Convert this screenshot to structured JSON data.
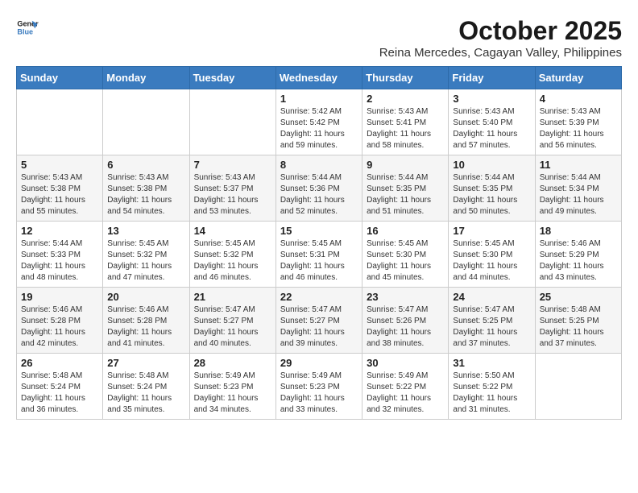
{
  "logo": {
    "line1": "General",
    "line2": "Blue"
  },
  "title": "October 2025",
  "subtitle": "Reina Mercedes, Cagayan Valley, Philippines",
  "weekdays": [
    "Sunday",
    "Monday",
    "Tuesday",
    "Wednesday",
    "Thursday",
    "Friday",
    "Saturday"
  ],
  "weeks": [
    [
      {
        "day": "",
        "info": ""
      },
      {
        "day": "",
        "info": ""
      },
      {
        "day": "",
        "info": ""
      },
      {
        "day": "1",
        "info": "Sunrise: 5:42 AM\nSunset: 5:42 PM\nDaylight: 11 hours\nand 59 minutes."
      },
      {
        "day": "2",
        "info": "Sunrise: 5:43 AM\nSunset: 5:41 PM\nDaylight: 11 hours\nand 58 minutes."
      },
      {
        "day": "3",
        "info": "Sunrise: 5:43 AM\nSunset: 5:40 PM\nDaylight: 11 hours\nand 57 minutes."
      },
      {
        "day": "4",
        "info": "Sunrise: 5:43 AM\nSunset: 5:39 PM\nDaylight: 11 hours\nand 56 minutes."
      }
    ],
    [
      {
        "day": "5",
        "info": "Sunrise: 5:43 AM\nSunset: 5:38 PM\nDaylight: 11 hours\nand 55 minutes."
      },
      {
        "day": "6",
        "info": "Sunrise: 5:43 AM\nSunset: 5:38 PM\nDaylight: 11 hours\nand 54 minutes."
      },
      {
        "day": "7",
        "info": "Sunrise: 5:43 AM\nSunset: 5:37 PM\nDaylight: 11 hours\nand 53 minutes."
      },
      {
        "day": "8",
        "info": "Sunrise: 5:44 AM\nSunset: 5:36 PM\nDaylight: 11 hours\nand 52 minutes."
      },
      {
        "day": "9",
        "info": "Sunrise: 5:44 AM\nSunset: 5:35 PM\nDaylight: 11 hours\nand 51 minutes."
      },
      {
        "day": "10",
        "info": "Sunrise: 5:44 AM\nSunset: 5:35 PM\nDaylight: 11 hours\nand 50 minutes."
      },
      {
        "day": "11",
        "info": "Sunrise: 5:44 AM\nSunset: 5:34 PM\nDaylight: 11 hours\nand 49 minutes."
      }
    ],
    [
      {
        "day": "12",
        "info": "Sunrise: 5:44 AM\nSunset: 5:33 PM\nDaylight: 11 hours\nand 48 minutes."
      },
      {
        "day": "13",
        "info": "Sunrise: 5:45 AM\nSunset: 5:32 PM\nDaylight: 11 hours\nand 47 minutes."
      },
      {
        "day": "14",
        "info": "Sunrise: 5:45 AM\nSunset: 5:32 PM\nDaylight: 11 hours\nand 46 minutes."
      },
      {
        "day": "15",
        "info": "Sunrise: 5:45 AM\nSunset: 5:31 PM\nDaylight: 11 hours\nand 46 minutes."
      },
      {
        "day": "16",
        "info": "Sunrise: 5:45 AM\nSunset: 5:30 PM\nDaylight: 11 hours\nand 45 minutes."
      },
      {
        "day": "17",
        "info": "Sunrise: 5:45 AM\nSunset: 5:30 PM\nDaylight: 11 hours\nand 44 minutes."
      },
      {
        "day": "18",
        "info": "Sunrise: 5:46 AM\nSunset: 5:29 PM\nDaylight: 11 hours\nand 43 minutes."
      }
    ],
    [
      {
        "day": "19",
        "info": "Sunrise: 5:46 AM\nSunset: 5:28 PM\nDaylight: 11 hours\nand 42 minutes."
      },
      {
        "day": "20",
        "info": "Sunrise: 5:46 AM\nSunset: 5:28 PM\nDaylight: 11 hours\nand 41 minutes."
      },
      {
        "day": "21",
        "info": "Sunrise: 5:47 AM\nSunset: 5:27 PM\nDaylight: 11 hours\nand 40 minutes."
      },
      {
        "day": "22",
        "info": "Sunrise: 5:47 AM\nSunset: 5:27 PM\nDaylight: 11 hours\nand 39 minutes."
      },
      {
        "day": "23",
        "info": "Sunrise: 5:47 AM\nSunset: 5:26 PM\nDaylight: 11 hours\nand 38 minutes."
      },
      {
        "day": "24",
        "info": "Sunrise: 5:47 AM\nSunset: 5:25 PM\nDaylight: 11 hours\nand 37 minutes."
      },
      {
        "day": "25",
        "info": "Sunrise: 5:48 AM\nSunset: 5:25 PM\nDaylight: 11 hours\nand 37 minutes."
      }
    ],
    [
      {
        "day": "26",
        "info": "Sunrise: 5:48 AM\nSunset: 5:24 PM\nDaylight: 11 hours\nand 36 minutes."
      },
      {
        "day": "27",
        "info": "Sunrise: 5:48 AM\nSunset: 5:24 PM\nDaylight: 11 hours\nand 35 minutes."
      },
      {
        "day": "28",
        "info": "Sunrise: 5:49 AM\nSunset: 5:23 PM\nDaylight: 11 hours\nand 34 minutes."
      },
      {
        "day": "29",
        "info": "Sunrise: 5:49 AM\nSunset: 5:23 PM\nDaylight: 11 hours\nand 33 minutes."
      },
      {
        "day": "30",
        "info": "Sunrise: 5:49 AM\nSunset: 5:22 PM\nDaylight: 11 hours\nand 32 minutes."
      },
      {
        "day": "31",
        "info": "Sunrise: 5:50 AM\nSunset: 5:22 PM\nDaylight: 11 hours\nand 31 minutes."
      },
      {
        "day": "",
        "info": ""
      }
    ]
  ]
}
